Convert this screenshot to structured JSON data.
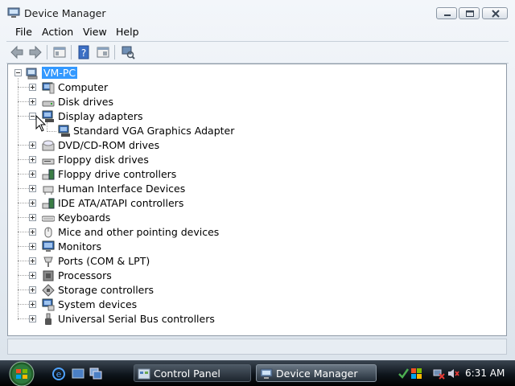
{
  "window": {
    "title": "Device Manager",
    "controls": [
      "minimize",
      "maximize",
      "close"
    ]
  },
  "menu": [
    "File",
    "Action",
    "View",
    "Help"
  ],
  "toolbar": {
    "buttons": [
      "back-icon",
      "forward-icon",
      "properties-icon",
      "help-icon",
      "update-driver-icon",
      "scan-hardware-icon"
    ]
  },
  "tree": {
    "root": "VM-PC",
    "categories": [
      {
        "label": "Computer",
        "icon": "computer-icon",
        "expanded": false
      },
      {
        "label": "Disk drives",
        "icon": "disk-drive-icon",
        "expanded": false
      },
      {
        "label": "Display adapters",
        "icon": "display-adapter-icon",
        "expanded": true,
        "children": [
          "Standard VGA Graphics Adapter"
        ]
      },
      {
        "label": "DVD/CD-ROM drives",
        "icon": "dvd-icon",
        "expanded": false
      },
      {
        "label": "Floppy disk drives",
        "icon": "floppy-icon",
        "expanded": false
      },
      {
        "label": "Floppy drive controllers",
        "icon": "floppy-controller-icon",
        "expanded": false
      },
      {
        "label": "Human Interface Devices",
        "icon": "hid-icon",
        "expanded": false
      },
      {
        "label": "IDE ATA/ATAPI controllers",
        "icon": "ide-controller-icon",
        "expanded": false
      },
      {
        "label": "Keyboards",
        "icon": "keyboard-icon",
        "expanded": false
      },
      {
        "label": "Mice and other pointing devices",
        "icon": "mouse-icon",
        "expanded": false
      },
      {
        "label": "Monitors",
        "icon": "monitor-icon",
        "expanded": false
      },
      {
        "label": "Ports (COM & LPT)",
        "icon": "port-icon",
        "expanded": false
      },
      {
        "label": "Processors",
        "icon": "processor-icon",
        "expanded": false
      },
      {
        "label": "Storage controllers",
        "icon": "storage-controller-icon",
        "expanded": false
      },
      {
        "label": "System devices",
        "icon": "system-device-icon",
        "expanded": false
      },
      {
        "label": "Universal Serial Bus controllers",
        "icon": "usb-icon",
        "expanded": false
      }
    ]
  },
  "taskbar": {
    "tasks": [
      {
        "label": "Control Panel",
        "icon": "control-panel-icon",
        "active": false
      },
      {
        "label": "Device Manager",
        "icon": "device-manager-icon",
        "active": true
      }
    ],
    "clock": "6:31 AM"
  },
  "colors": {
    "selection": "#3399ff",
    "taskbar": "#0e151c"
  }
}
